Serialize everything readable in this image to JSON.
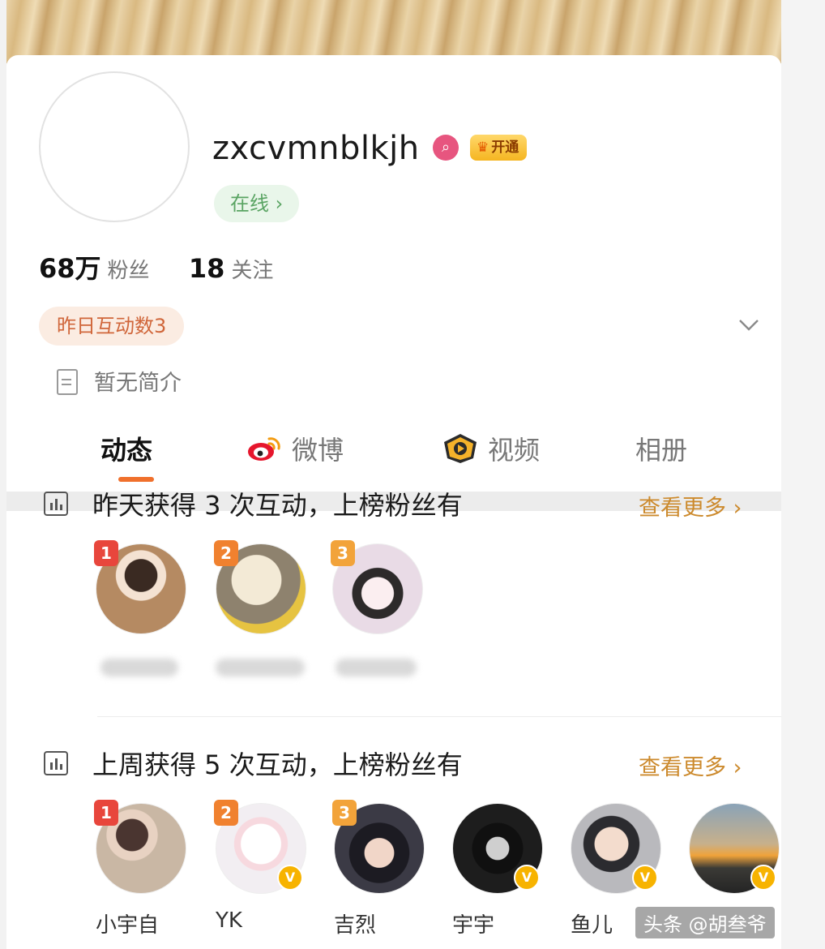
{
  "profile": {
    "username": "zxcvmnblkjh",
    "vip_label": "开通",
    "online_label": "在线 ›",
    "followers_count": "68万",
    "followers_label": "粉丝",
    "following_count": "18",
    "following_label": "关注",
    "interaction_label": "昨日互动数3",
    "bio": "暂无简介"
  },
  "tabs": [
    {
      "label": "动态",
      "active": true
    },
    {
      "label": "微博",
      "icon": "weibo-icon"
    },
    {
      "label": "视频",
      "icon": "video-icon"
    },
    {
      "label": "相册"
    }
  ],
  "sections": [
    {
      "title": "昨天获得 3 次互动，上榜粉丝有",
      "more": "查看更多 ›",
      "fans": [
        {
          "rank": "1",
          "color": "#b58a62"
        },
        {
          "rank": "2",
          "color": "#e8d8b8"
        },
        {
          "rank": "3",
          "color": "#e9dbe6"
        }
      ]
    },
    {
      "title": "上周获得 5 次互动，上榜粉丝有",
      "more": "查看更多 ›",
      "fans": [
        {
          "rank": "1",
          "name": "小宇自",
          "color": "#c9b7a4"
        },
        {
          "rank": "2",
          "name": "YK",
          "color": "#f2eef2",
          "verified": "V"
        },
        {
          "rank": "3",
          "name": "吉烈",
          "color": "#3b3a45"
        },
        {
          "name": "宇宇",
          "color": "#1d1d1d",
          "verified": "V"
        },
        {
          "name": "鱼儿",
          "color": "#b9b9bd",
          "verified": "V"
        },
        {
          "color": "#d19a52",
          "verified": "V"
        }
      ]
    }
  ],
  "watermark": "头条 @胡叁爷",
  "colors": {
    "accent": "#f0702c",
    "more_link": "#cc8a2d",
    "online": "#5aa463"
  }
}
